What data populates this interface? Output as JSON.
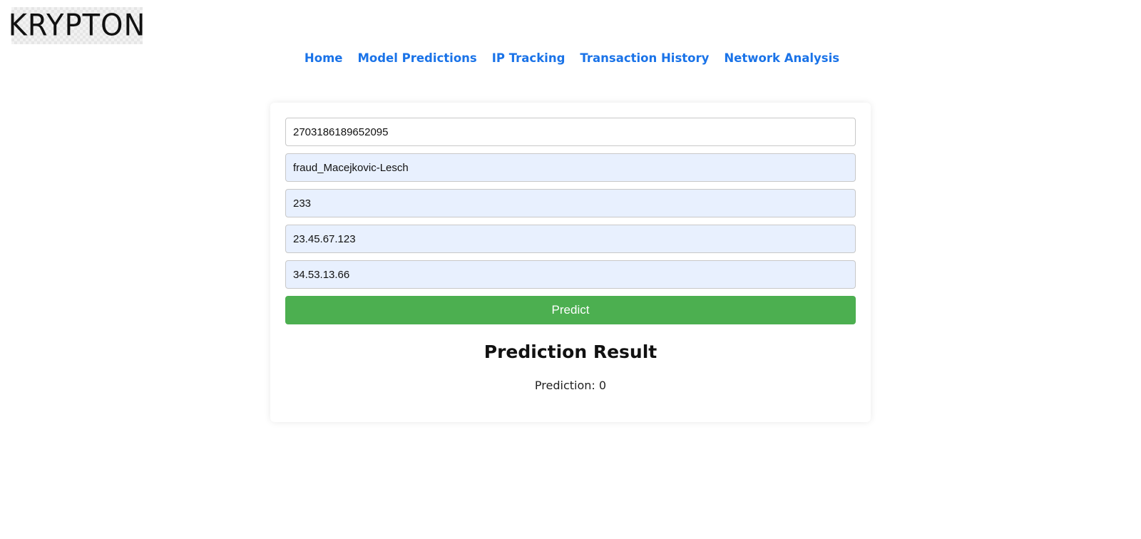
{
  "brand": {
    "logo_text": "KRYPTON"
  },
  "nav": {
    "items": [
      {
        "label": "Home"
      },
      {
        "label": "Model Predictions"
      },
      {
        "label": "IP Tracking"
      },
      {
        "label": "Transaction History"
      },
      {
        "label": "Network Analysis"
      }
    ],
    "link_color": "#1a73e8"
  },
  "form": {
    "fields": [
      {
        "value": "2703186189652095"
      },
      {
        "value": "fraud_Macejkovic-Lesch"
      },
      {
        "value": "233"
      },
      {
        "value": "23.45.67.123"
      },
      {
        "value": "34.53.13.66"
      }
    ],
    "autofill_color": "#e8f0fe",
    "submit_label": "Predict",
    "submit_color": "#4caf50"
  },
  "result": {
    "title": "Prediction Result",
    "text": "Prediction: 0"
  }
}
